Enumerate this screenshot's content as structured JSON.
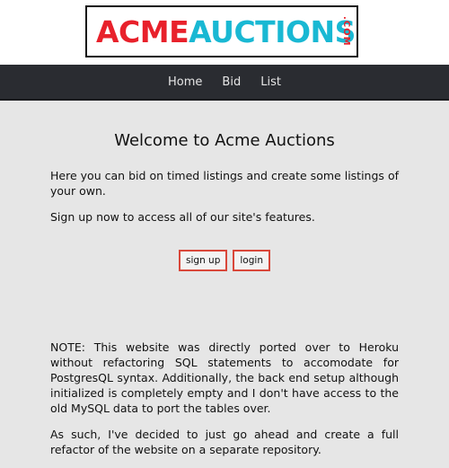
{
  "logo": {
    "part1": "ACME",
    "part2": "AUCTIONS",
    "suffix": ".COM"
  },
  "nav": {
    "items": [
      "Home",
      "Bid",
      "List"
    ]
  },
  "main": {
    "title": "Welcome to Acme Auctions",
    "intro": "Here you can bid on timed listings and create some listings of your own.",
    "signup_prompt": "Sign up now to access all of our site's features.",
    "buttons": {
      "signup": "sign up",
      "login": "login"
    }
  },
  "notice": {
    "p1": "NOTE: This website was directly ported over to Heroku without refactoring SQL statements to accomodate for PostgresQL syntax. Additionally, the back end setup although initialized is completely empty and I don't have access to the old MySQL data to port the tables over.",
    "p2": "As such, I've decided to just go ahead and create a full refactor of the website on a separate repository."
  },
  "colors": {
    "logo_red": "#e8212b",
    "logo_cyan": "#19b8d3",
    "nav_bg": "#2a2c31",
    "button_border": "#d9473a"
  }
}
